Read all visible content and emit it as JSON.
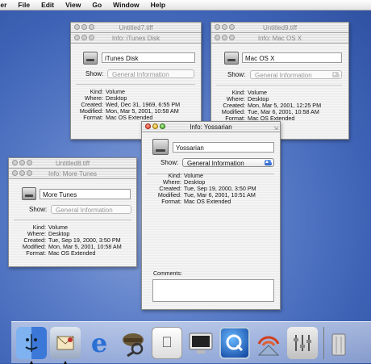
{
  "menubar": {
    "app": "ler",
    "items": [
      "File",
      "Edit",
      "View",
      "Go",
      "Window",
      "Help"
    ]
  },
  "windows": {
    "untitled7": {
      "doc_title": "Untitled7.tiff",
      "title": "Info: iTunes Disk",
      "name": "iTunes Disk",
      "show_label": "Show:",
      "show_value": "General Information",
      "info": [
        {
          "k": "Kind:",
          "v": "Volume"
        },
        {
          "k": "Where:",
          "v": "Desktop"
        },
        {
          "k": "Created:",
          "v": "Wed, Dec 31, 1969, 6:55 PM"
        },
        {
          "k": "Modified:",
          "v": "Mon, Mar 5, 2001, 10:58 AM"
        },
        {
          "k": "Format:",
          "v": "Mac OS Extended"
        }
      ]
    },
    "untitled9": {
      "doc_title": "Untitled9.tiff",
      "title": "Info: Mac OS X",
      "name": "Mac OS X",
      "show_label": "Show:",
      "show_value": "General Information",
      "info": [
        {
          "k": "Kind:",
          "v": "Volume"
        },
        {
          "k": "Where:",
          "v": "Desktop"
        },
        {
          "k": "Created:",
          "v": "Mon, Mar 5, 2001, 12:25 PM"
        },
        {
          "k": "Modified:",
          "v": "Tue, Mar 6, 2001, 10:58 AM"
        },
        {
          "k": "Format:",
          "v": "Mac OS Extended"
        }
      ]
    },
    "untitled8": {
      "doc_title": "Untitled8.tiff",
      "title": "Info: More Tunes",
      "name": "More Tunes",
      "show_label": "Show:",
      "show_value": "General Information",
      "info": [
        {
          "k": "Kind:",
          "v": "Volume"
        },
        {
          "k": "Where:",
          "v": "Desktop"
        },
        {
          "k": "Created:",
          "v": "Tue, Sep 19, 2000, 3:50 PM"
        },
        {
          "k": "Modified:",
          "v": "Mon, Mar 5, 2001, 10:58 AM"
        },
        {
          "k": "Format:",
          "v": "Mac OS Extended"
        }
      ]
    },
    "yossarian": {
      "title": "Info: Yossarian",
      "name": "Yossarian",
      "show_label": "Show:",
      "show_value": "General Information",
      "info": [
        {
          "k": "Kind:",
          "v": "Volume"
        },
        {
          "k": "Where:",
          "v": "Desktop"
        },
        {
          "k": "Created:",
          "v": "Tue, Sep 19, 2000, 3:50 PM"
        },
        {
          "k": "Modified:",
          "v": "Tue, Mar 6, 2001, 10:51 AM"
        },
        {
          "k": "Format:",
          "v": "Mac OS Extended"
        }
      ],
      "comments_label": "Comments:",
      "comments": ""
    }
  },
  "dock": {
    "items": [
      "finder-icon",
      "mail-icon",
      "internet-explorer-icon",
      "sherlock-icon",
      "apple-tour-icon",
      "monitor-icon",
      "quicktime-icon",
      "airport-icon",
      "system-preferences-icon",
      "trash-icon"
    ]
  }
}
